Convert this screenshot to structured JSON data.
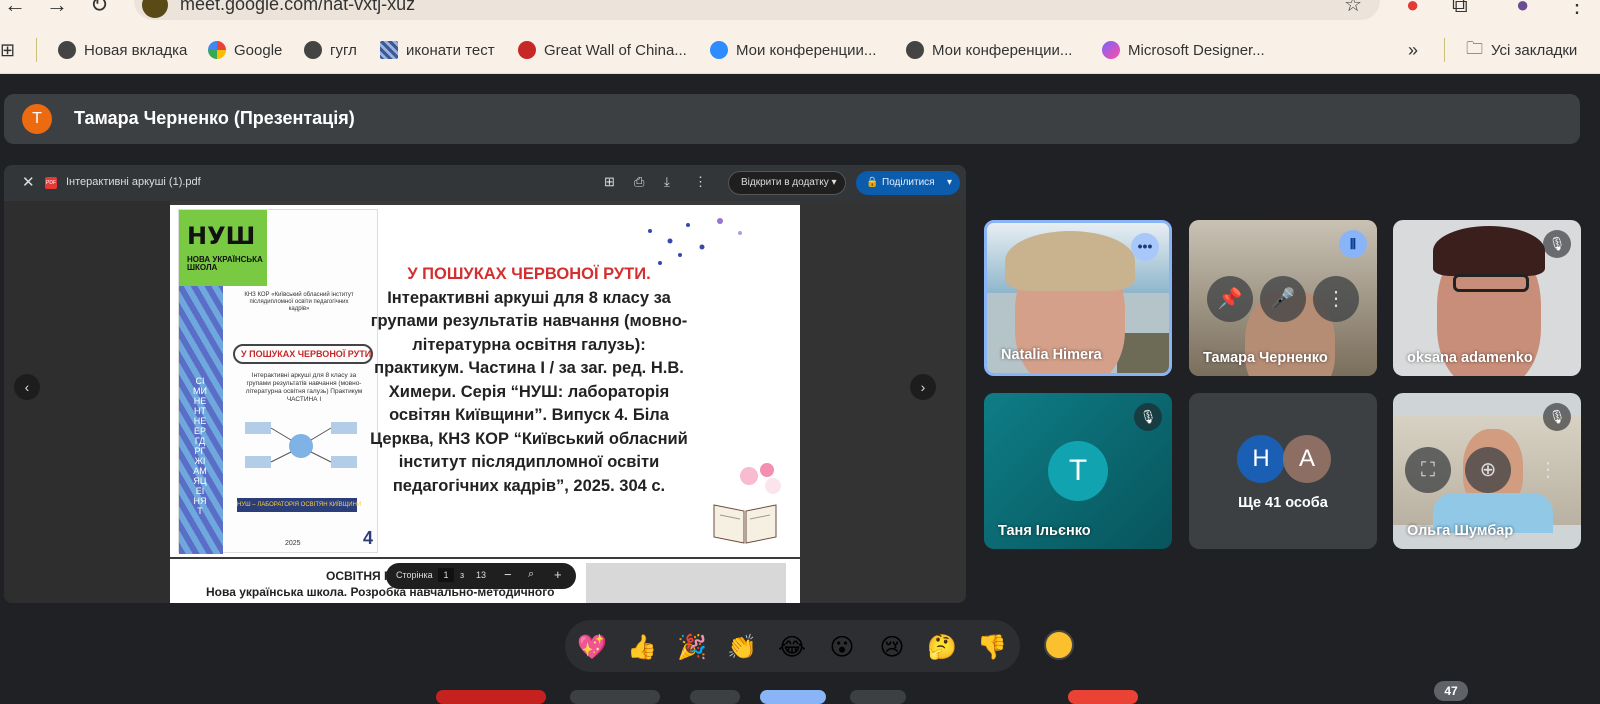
{
  "browser": {
    "url": "meet.google.com/nat-vxtj-xuz",
    "bookmarks": [
      {
        "label": "Новая вкладка",
        "icon": "globe-icon"
      },
      {
        "label": "Google",
        "icon": "google-icon"
      },
      {
        "label": "гугл",
        "icon": "globe-icon"
      },
      {
        "label": "иконати тест",
        "icon": "stripe-icon"
      },
      {
        "label": "Great Wall of China...",
        "icon": "dragon-icon"
      },
      {
        "label": "Мои конференции...",
        "icon": "zoom-icon"
      },
      {
        "label": "Мои конференции...",
        "icon": "globe-icon"
      },
      {
        "label": "Microsoft Designer...",
        "icon": "designer-icon"
      }
    ],
    "overflow": "»",
    "all_bookmarks": "Усі закладки"
  },
  "meet": {
    "presenter_initial": "Т",
    "presenter_title": "Тамара Черненко (Презентація)",
    "presentation": {
      "file_name": "Інтерактивні аркуші (1).pdf",
      "open_with": "Відкрити в додатку",
      "share": "Поділитися",
      "cover": {
        "nush_big": "НУШ",
        "nush_small": "НОВА УКРАЇНСЬКА ШКОЛА",
        "side_letters": "СІМИНЕНТНЕЕРГДРГЖІАМЯЦЕІНЯТ",
        "org": "КНЗ КОР «Київський обласний інститут післядипломної освіти педагогічних кадрів»",
        "pill": "У ПОШУКАХ ЧЕРВОНОЇ РУТИ",
        "sub": "Інтерактивні аркуші для 8 класу за групами результатів навчання (мовно-літературна освітня галузь) Практикум ЧАСТИНА І",
        "banner": "НУШ – ЛАБОРАТОРІЯ ОСВІТЯН КИЇВЩИНИ",
        "year": "2025",
        "number": "4"
      },
      "headline": "У ПОШУКАХ ЧЕРВОНОЇ РУТИ.",
      "description": "Інтерактивні аркуші для 8 класу за групами результатів навчання (мовно-літературна освітня галузь): практикум. Частина І / за заг. ред. Н.В. Химери. Серія “НУШ: лабораторія освітян Київщини”. Випуск 4. Біла Церква, КНЗ КОР “Київський обласний інститут післядипломної освіти педагогічних кадрів”, 2025. 304 с.",
      "page2_line1": "ОСВІТНЯ МА",
      "page2_line2": "Нова українська школа. Розробка навчально-методичного",
      "page_label": "Сторінка",
      "page_current": "1",
      "page_of": "з",
      "page_total": "13"
    },
    "participants": [
      {
        "name": "Natalia Himera"
      },
      {
        "name": "Тамара Черненко"
      },
      {
        "name": "oksana adamenko"
      },
      {
        "name": "Таня Ільєнко",
        "initial": "Т"
      },
      {
        "name": "Ще 41 особа",
        "initials": [
          "Н",
          "А"
        ]
      },
      {
        "name": "Ольга Шумбар"
      }
    ],
    "reactions": [
      "💖",
      "👍",
      "🎉",
      "👏",
      "😂",
      "😮",
      "😢",
      "🤔",
      "👎"
    ],
    "participant_count": "47"
  },
  "colors": {
    "meet_bg": "#202124",
    "tile_bg": "#3c4043",
    "teal_tile": "#0b6a73",
    "accent_blue": "#8ab4f8",
    "presenter_orange": "#ec6a10"
  }
}
